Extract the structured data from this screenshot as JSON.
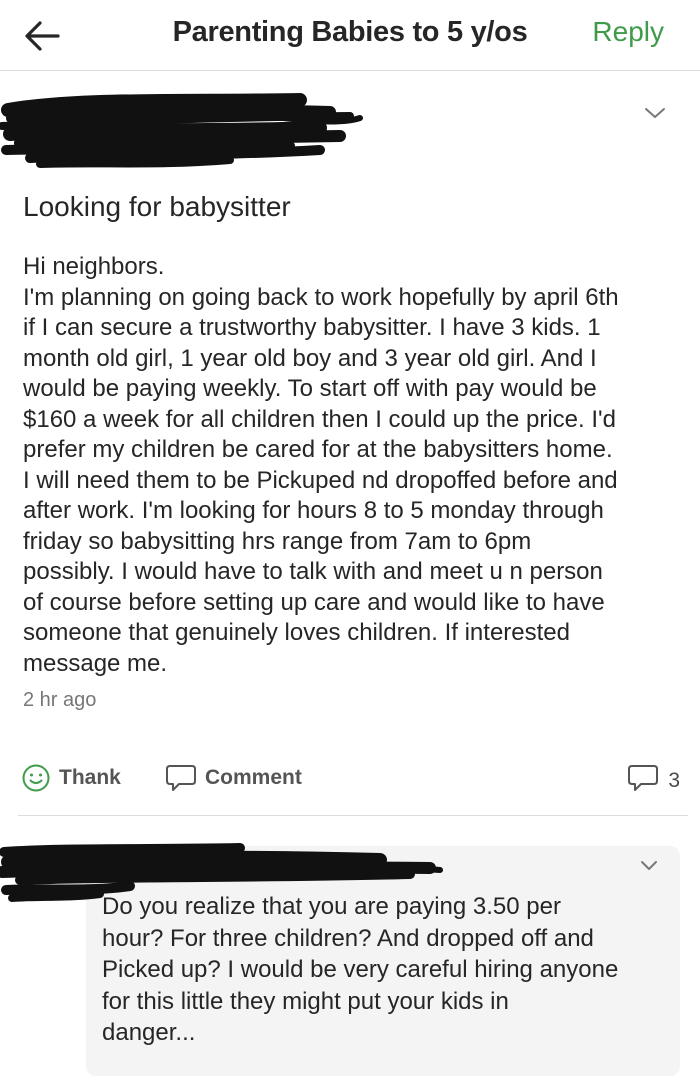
{
  "header": {
    "title": "Parenting Babies to 5 y/os",
    "reply_label": "Reply",
    "back_icon": "back-arrow-icon"
  },
  "post": {
    "title": "Looking for babysitter",
    "body_lines": [
      "Hi neighbors.",
      "I'm planning on going back to work hopefully by april 6th",
      "if I can secure a trustworthy babysitter. I have 3 kids. 1",
      "month old girl, 1 year old boy and 3 year old girl. And I",
      "would be paying weekly. To start off with pay would be",
      "$160 a week for all children then I could up the price. I'd",
      "prefer my children be cared for at the babysitters home.",
      "I will need them to be Pickuped nd dropoffed before and",
      "after work. I'm looking for hours 8 to 5 monday through",
      "friday so babysitting hrs range from 7am to 6pm",
      "possibly. I would have to talk with and meet u n person",
      "of course before setting up care and would like to have",
      "someone that genuinely loves children. If interested",
      "message me."
    ],
    "timestamp": "2 hr ago"
  },
  "actions": {
    "thank_label": "Thank",
    "comment_label": "Comment",
    "comment_count": "3"
  },
  "comment": {
    "text_lines": [
      "Do you realize that you are paying 3.50 per",
      "hour?  For three children? And dropped off and",
      "Picked up? I would be very careful hiring anyone",
      "for this little they might put your kids in",
      "danger..."
    ]
  },
  "colors": {
    "accent_green": "#3f9a4a",
    "text": "#262626",
    "muted": "#777777",
    "divider": "#dcdcdc",
    "bubble": "#f4f4f4"
  }
}
